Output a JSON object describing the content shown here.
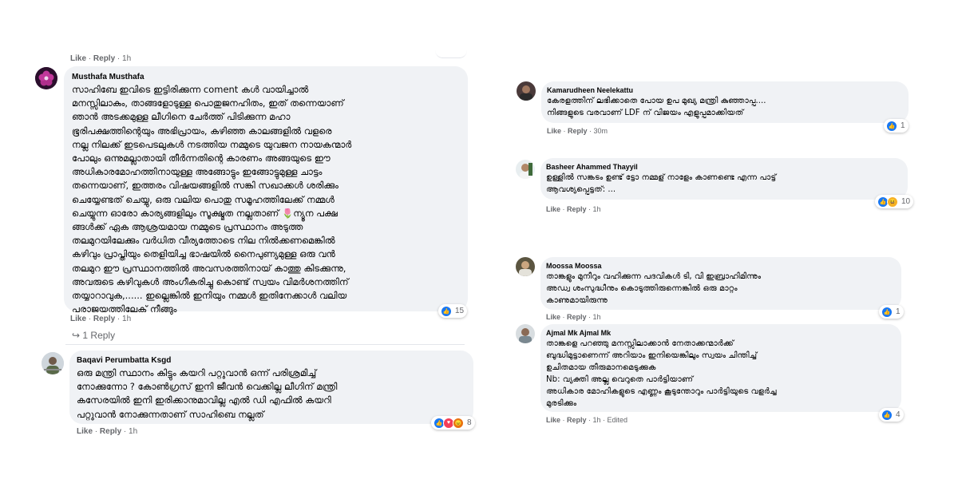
{
  "top_meta": {
    "like": "Like",
    "reply": "Reply",
    "time": "1h"
  },
  "left": [
    {
      "author": "Musthafa Musthafa",
      "text": "സാഹിബേ ഇവിടെ ഇട്ടിരിക്കുന്ന coment കൾ വായിച്ചാൽ\nമനസ്സിലാകും, താങ്ങളോടുള്ള പൊതുജനഹിതം, ഇത് തന്നെയാണ്\nഞാൻ അടക്കമുള്ള ലീഗിനെ ചേർത്ത് പിടിക്കുന്ന മഹാ\nഭൂരിപക്ഷത്തിന്റെയും അഭിപ്രായം, കഴിഞ്ഞ കാലങ്ങളിൽ വളരെ\nനല്ല നിലക്ക് ഇടപെടലുകൾ നടത്തിയ നമ്മുടെ യുവജന നായകന്മാർ\nപോലും ഒന്നുമല്ലാതായി തീർന്നതിന്റെ കാരണം അങ്ങയുടെ ഈ\nഅധികാരമോഹത്തിനായുള്ള അങ്ങോട്ടും ഇങ്ങോട്ടുമുള്ള ചാട്ടം\nതന്നെയാണ്, ഇത്തരം വിഷയങ്ങളിൽ സങ്കി സഖാക്കൾ ശരിക്കും\nചെയ്യേണ്ടത് ചെയ്യു, ഒരു വലിയ പൊതു സമൂഹത്തിലേക്ക് നമ്മൾ\nചെയ്യുന്ന ഓരോ കാര്യങ്ങളിലും സൂക്ഷ്മത നല്ലതാണ് 🌷ന്യൂന പക്ഷ\nങ്ങൾക്ക് ഏക ആശ്രയമായ നമ്മുടെ പ്രസ്ഥാനം അടുത്ത\nതലമുറയിലേക്കും വർധിത വീര്യത്തോടെ നില നിൽക്കണമെങ്കിൽ\nകഴിവും പ്രാപ്തിയും തെളിയിച്ച ഭാഷയിൽ നൈപുണ്യമുള്ള ഒരു വൻ\nതലമുറ ഈ പ്രസ്ഥാനത്തിൽ അവസരത്തിനായ് കാത്തു കിടക്കുന്നു,\nഅവരുടെ കഴിവുകൾ അംഗീകരിച്ചു കൊണ്ട് സ്വയം വിമർശനത്തിന്\nതയ്യാറാവുക,...... ഇല്ലെങ്കിൽ ഇനിയും നമ്മൾ ഇതിനേക്കാൾ വലിയ\nപരാജയത്തിലേക് നീങ്ങും",
      "like": "Like",
      "reply": "Reply",
      "time": "1h",
      "reaction_count": "15",
      "reactions": [
        "like"
      ],
      "replies_label": "1 Reply"
    },
    {
      "author": "Baqavi Perumbatta Ksgd",
      "text": "ഒരു മന്ത്രി സ്ഥാനം കിട്ടും കയറി പറ്റുവാൻ ഒന്ന് പരിശ്രമിച്ച്\nനോക്കുന്നോ ? കോൺഗ്രസ് ഇനി ജീവൻ വെക്കില്ല ലീഗിന് മന്ത്രി\nകസേരയിൽ ഇനി ഇരിക്കാനുമാവില്ല എൽ ഡി എഫിൽ കയറി\nപറ്റുവാൻ നോക്കുന്നതാണ് സാഹിബെ നല്ലത്",
      "like": "Like",
      "reply": "Reply",
      "time": "1h",
      "reaction_count": "8",
      "reactions": [
        "like",
        "love",
        "angry"
      ]
    }
  ],
  "right": [
    {
      "author": "Kamarudheen Neelekattu",
      "text": "കേരളത്തിന് ലഭിക്കാതെ പോയ ഉപ മുഖ്യ മന്ത്രി കുഞ്ഞാപ്പ....\nനിങ്ങളുടെ വരവാണ് LDF ന് വിജയം എളുപ്പമാക്കിയത്",
      "like": "Like",
      "reply": "Reply",
      "time": "30m",
      "reaction_count": "1",
      "reactions": [
        "like"
      ]
    },
    {
      "author": "Basheer Ahammed Thayyil",
      "text": "ഉള്ളിൽ സങ്കടം ഉണ്ട് ട്ടോ നമ്മള് നാളേം കാണണ്ടെ എന്ന പാട്ട്\nആവശ്യപ്പെട്ടത്: ...",
      "like": "Like",
      "reply": "Reply",
      "time": "1h",
      "reaction_count": "10",
      "reactions": [
        "like",
        "haha"
      ]
    },
    {
      "author": "Moossa Moossa",
      "text": "താങ്കളും മുനീറും വഹിക്കുന്ന പദവികൾ ടി, വി ഇബ്രാഹിമിന്നും\nഅഡ്വ ശംസുദ്ധീനും കൊടുത്തിരുന്നെങ്കിൽ ഒരു മാറ്റം\nകാണുമായിരുന്നു",
      "like": "Like",
      "reply": "Reply",
      "time": "1h",
      "reaction_count": "1",
      "reactions": [
        "like"
      ]
    },
    {
      "author": "Ajmal Mk Ajmal Mk",
      "text": "താങ്കളെ പറഞ്ഞു മനസ്സിലാക്കാൻ നേതാക്കന്മാർക്ക്\nബുദ്ധിമുട്ടാണെന്ന് അറിയാം ഇനിയെങ്കിലും സ്വയം ചിന്തിച്ച്\nഉചിതമായ തീരുമാനമെടുക്കുക\nNb: വ്യക്തി അല്ല വെറുതെ പാർട്ടിയാണ്\nഅധികാര മോഹികളുടെ എണ്ണം കൂടുന്തോറും പാർട്ടിയുടെ വളർച്ച\nമുരടിക്കും",
      "like": "Like",
      "reply": "Reply",
      "time": "1h",
      "edited": "Edited",
      "reaction_count": "4",
      "reactions": [
        "like"
      ]
    }
  ]
}
